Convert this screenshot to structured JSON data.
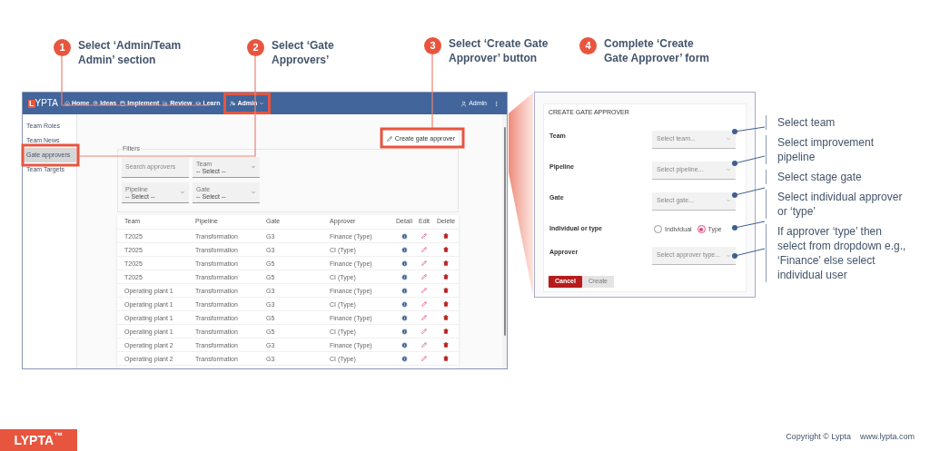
{
  "steps": [
    {
      "number": "1",
      "text": "Select ‘Admin/Team Admin’ section"
    },
    {
      "number": "2",
      "text": "Select ‘Gate Approvers’"
    },
    {
      "number": "3",
      "text": "Select ‘Create Gate Approver’ button"
    },
    {
      "number": "4",
      "text": "Complete ‘Create Gate Approver’ form"
    }
  ],
  "app": {
    "logo": {
      "initial": "L",
      "rest": "YPTA"
    },
    "nav": [
      "Home",
      "Ideas",
      "Implement",
      "Review",
      "Learn",
      "Admin"
    ],
    "user": "Admin",
    "sidebar": [
      {
        "label": "Team Roles",
        "selected": false
      },
      {
        "label": "Team News",
        "selected": false
      },
      {
        "label": "Gate approvers",
        "selected": true
      },
      {
        "label": "Team Targets",
        "selected": false
      }
    ],
    "create_button": "Create gate approver",
    "filters": {
      "title": "Filters",
      "search_placeholder": "Search approvers",
      "selects": [
        {
          "label": "Team",
          "value": "-- Select --"
        },
        {
          "label": "Pipeline",
          "value": "-- Select --"
        },
        {
          "label": "Gate",
          "value": "-- Select --"
        }
      ]
    },
    "table": {
      "columns": [
        "Team",
        "Pipeline",
        "Gate",
        "Approver",
        "Detail",
        "Edit",
        "Delete"
      ],
      "rows": [
        [
          "T2025",
          "Transformation",
          "G3",
          "Finance (Type)"
        ],
        [
          "T2025",
          "Transformation",
          "G3",
          "CI (Type)"
        ],
        [
          "T2025",
          "Transformation",
          "G5",
          "Finance (Type)"
        ],
        [
          "T2025",
          "Transformation",
          "G5",
          "CI (Type)"
        ],
        [
          "Operating plant 1",
          "Transformation",
          "G3",
          "Finance (Type)"
        ],
        [
          "Operating plant 1",
          "Transformation",
          "G3",
          "CI (Type)"
        ],
        [
          "Operating plant 1",
          "Transformation",
          "G5",
          "Finance (Type)"
        ],
        [
          "Operating plant 1",
          "Transformation",
          "G5",
          "CI (Type)"
        ],
        [
          "Operating plant 2",
          "Transformation",
          "G3",
          "Finance (Type)"
        ],
        [
          "Operating plant 2",
          "Transformation",
          "G3",
          "CI (Type)"
        ]
      ]
    }
  },
  "form": {
    "title": "CREATE GATE APPROVER",
    "fields": [
      {
        "label": "Team",
        "kind": "select",
        "placeholder": "Select team..."
      },
      {
        "label": "Pipeline",
        "kind": "select",
        "placeholder": "Select pipeline..."
      },
      {
        "label": "Gate",
        "kind": "select",
        "placeholder": "Select gate..."
      },
      {
        "label": "Individual or type",
        "kind": "radio",
        "options": [
          {
            "label": "Individual",
            "selected": false
          },
          {
            "label": "Type",
            "selected": true
          }
        ]
      },
      {
        "label": "Approver",
        "kind": "select",
        "placeholder": "Select approver type..."
      }
    ],
    "buttons": [
      {
        "label": "Cancel",
        "disabled": false
      },
      {
        "label": "Create",
        "disabled": true
      }
    ]
  },
  "notes": [
    "Select team",
    "Select improvement pipeline",
    "Select stage gate",
    "Select individual approver or ‘type’",
    "If approver ‘type’ then select from dropdown e.g., ‘Finance’ else select individual user"
  ],
  "footer": {
    "logo": "LYPTA$^{™}$",
    "copyright": "Copyright © Lypta",
    "website": "www.lypta.com"
  }
}
